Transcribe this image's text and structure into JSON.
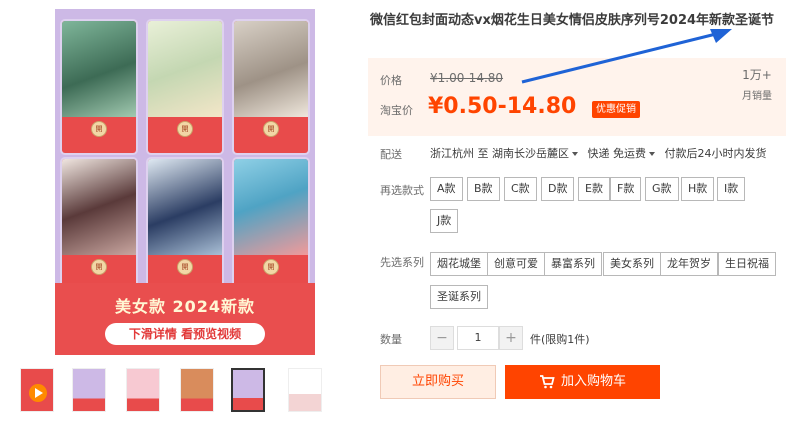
{
  "product": {
    "title": "微信红包封面动态vx烟花生日美女情侣皮肤序列号2024年新款圣诞节"
  },
  "gallery": {
    "banner_title": "美女款 2024新款",
    "banner_sub": "下滑详情 看预览视频",
    "seal_text": "開",
    "thumb_count": 6,
    "active_thumb_index": 4
  },
  "price": {
    "label": "价格",
    "original": "¥1.00-14.80",
    "taobao_label": "淘宝价",
    "current": "¥0.50-14.80",
    "promo_badge": "优惠促销"
  },
  "sales": {
    "count": "1万+",
    "unit": "月销量"
  },
  "delivery": {
    "label": "配送",
    "from": "浙江杭州 至",
    "to": "湖南长沙岳麓区",
    "method": "快递 免运费",
    "note": "付款后24小时内发货"
  },
  "style_option": {
    "label": "再选款式",
    "options": [
      "A款",
      "B款",
      "C款",
      "D款",
      "E款",
      "F款",
      "G款",
      "H款",
      "I款",
      "J款"
    ]
  },
  "series_option": {
    "label": "先选系列",
    "options": [
      "烟花城堡",
      "创意可爱",
      "暴富系列",
      "美女系列",
      "龙年贺岁",
      "生日祝福",
      "圣诞系列"
    ]
  },
  "quantity": {
    "label": "数量",
    "value": "1",
    "minus": "−",
    "plus": "+",
    "limit_text": "件(限购1件)"
  },
  "actions": {
    "buy_now": "立即购买",
    "add_cart": "加入购物车"
  },
  "colors": {
    "accent": "#ff4400",
    "price_bg": "#fff3ec",
    "gallery_bg": "#cdb9e6",
    "envelope_red": "#e84b4b"
  }
}
